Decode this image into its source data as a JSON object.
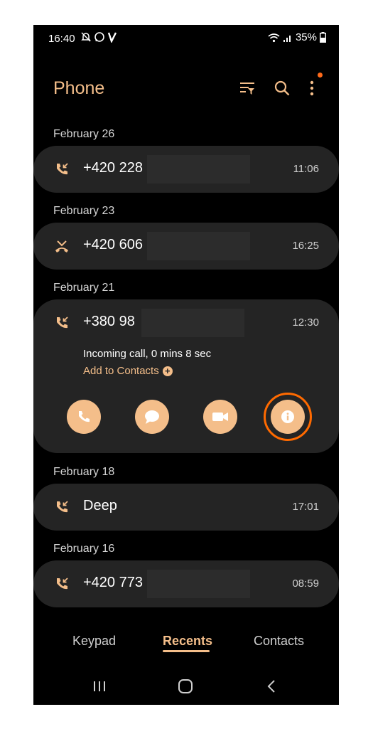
{
  "status_bar": {
    "time": "16:40",
    "battery": "35%"
  },
  "header": {
    "title": "Phone"
  },
  "recents": [
    {
      "date": "February 26",
      "number": "+420 228",
      "time": "11:06",
      "call_type": "incoming"
    },
    {
      "date": "February 23",
      "number": "+420 606",
      "time": "16:25",
      "call_type": "missed"
    },
    {
      "date": "February 21",
      "number": "+380 98",
      "time": "12:30",
      "call_type": "incoming",
      "detail": "Incoming call, 0 mins 8 sec",
      "add_contact": "Add to Contacts"
    },
    {
      "date": "February 18",
      "number": "Deep",
      "time": "17:01",
      "call_type": "incoming"
    },
    {
      "date": "February 16",
      "number": "+420 773",
      "time": "08:59",
      "call_type": "incoming"
    }
  ],
  "actions": [
    "call-icon",
    "message-icon",
    "video-call-icon",
    "info-icon"
  ],
  "tabs": [
    "Keypad",
    "Recents",
    "Contacts"
  ],
  "active_tab": "Recents",
  "colors": {
    "accent": "#f4be8a",
    "highlight_ring": "#ff6a00",
    "card_bg": "#242424",
    "background": "#000000"
  }
}
